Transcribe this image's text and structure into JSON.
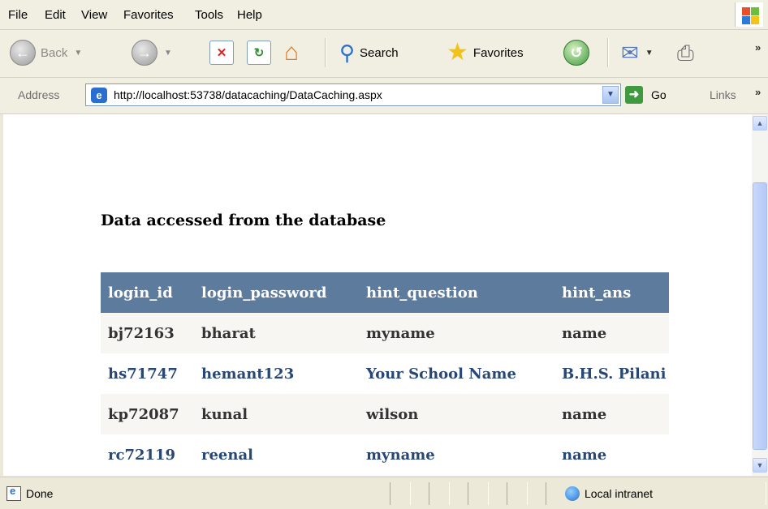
{
  "menu": [
    "File",
    "Edit",
    "View",
    "Favorites",
    "Tools",
    "Help"
  ],
  "toolbar": {
    "back_label": "Back",
    "search_label": "Search",
    "favorites_label": "Favorites",
    "overflow": "»"
  },
  "addressbar": {
    "label": "Address",
    "url": "http://localhost:53738/datacaching/DataCaching.aspx",
    "go_label": "Go",
    "links_label": "Links",
    "overflow": "»"
  },
  "page": {
    "heading": "Data accessed from the database",
    "columns": [
      "login_id",
      "login_password",
      "hint_question",
      "hint_ans"
    ],
    "rows": [
      [
        "bj72163",
        "bharat",
        "myname",
        "name"
      ],
      [
        "hs71747",
        "hemant123",
        "Your School Name",
        "B.H.S. Pilani"
      ],
      [
        "kp72087",
        "kunal",
        "wilson",
        "name"
      ],
      [
        "rc72119",
        "reenal",
        "myname",
        "name"
      ]
    ],
    "header_color": "#5D7B9D",
    "odd_row_color": "#F7F6F3",
    "even_row_text_color": "#284775"
  },
  "status": {
    "text": "Done",
    "zone": "Local intranet"
  },
  "icons": {
    "back": "back-arrow-icon",
    "forward": "forward-arrow-icon",
    "stop": "stop-icon",
    "refresh": "refresh-icon",
    "home": "home-icon",
    "search": "magnifier-icon",
    "favorites": "star-icon",
    "history": "history-icon",
    "mail": "mail-icon",
    "print": "printer-icon"
  }
}
